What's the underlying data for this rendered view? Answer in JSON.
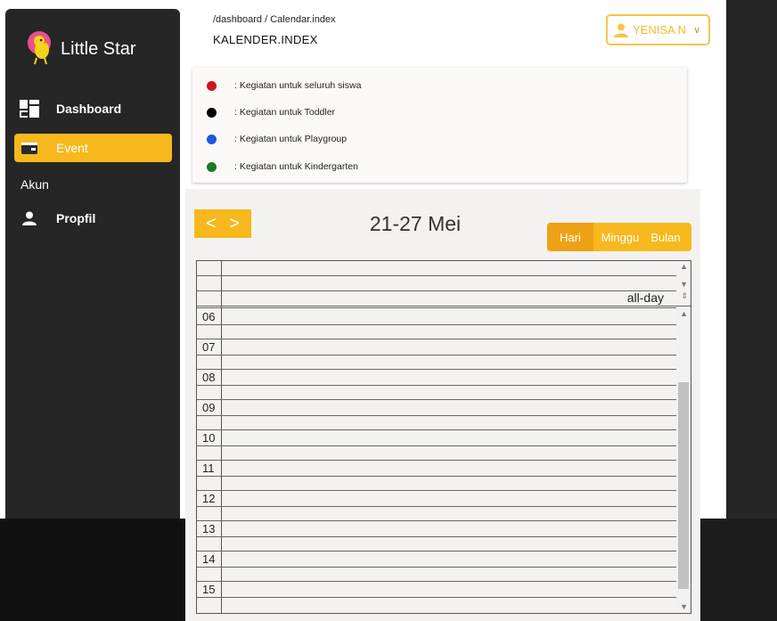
{
  "sidebar": {
    "brand": "Little Star",
    "nav": [
      {
        "label": "Dashboard",
        "icon": "dashboard-icon"
      },
      {
        "label": "Event",
        "icon": "wallet-icon",
        "active": true
      }
    ],
    "section": "Akun",
    "account_nav": [
      {
        "label": "Propfil",
        "icon": "person-icon"
      }
    ]
  },
  "header": {
    "breadcrumb": "/dashboard / Calendar.index",
    "title": "KALENDER.INDEX",
    "user": "YENISA N",
    "user_chevron": "v"
  },
  "legend": [
    {
      "color": "#d0161a",
      "label": ": Kegiatan untuk seluruh siswa"
    },
    {
      "color": "#000000",
      "label": ": Kegiatan untuk Toddler"
    },
    {
      "color": "#1f55e0",
      "label": ": Kegiatan untuk Playgroup"
    },
    {
      "color": "#1e7a22",
      "label": ": Kegiatan untuk Kindergarten"
    }
  ],
  "calendar": {
    "title": "21-27 Mei",
    "prev": "<",
    "next": ">",
    "views": [
      "Hari",
      "Minggu",
      "Bulan"
    ],
    "active_view": "Hari",
    "allday_label": "all-day",
    "hours": [
      "06",
      "07",
      "08",
      "09",
      "10",
      "11",
      "12",
      "13",
      "14",
      "15"
    ]
  },
  "colors": {
    "accent": "#f6b81c",
    "sidebar_bg": "#262626"
  }
}
